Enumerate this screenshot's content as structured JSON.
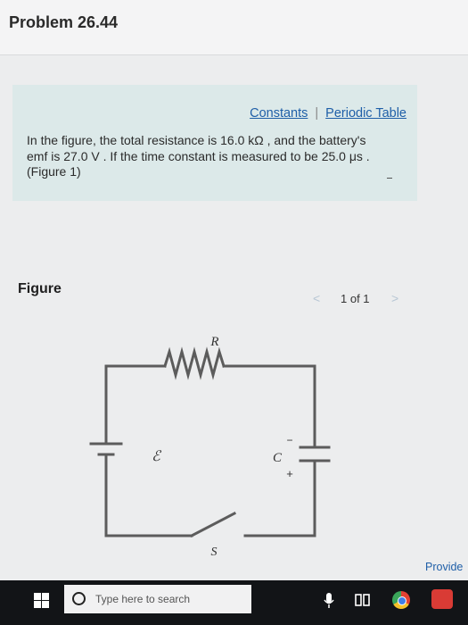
{
  "problem": {
    "title": "Problem 26.44"
  },
  "panel": {
    "constants_link": "Constants",
    "separator": "|",
    "periodic_link": "Periodic Table",
    "line1": "In the figure, the total resistance is 16.0 kΩ , and the battery's",
    "line2": "emf is 27.0 V . If the time constant is measured to be 25.0 μs .",
    "figure_ref": "(Figure 1)"
  },
  "figure": {
    "label": "Figure",
    "pager_text": "1 of 1",
    "prev_glyph": "<",
    "next_glyph": ">",
    "labels": {
      "resistor": "R",
      "battery": "ℰ",
      "capacitor": "C",
      "minus": "−",
      "plus": "+",
      "switch": "S"
    }
  },
  "provide_link": "Provide",
  "taskbar": {
    "search_placeholder": "Type here to search"
  },
  "colors": {
    "panel_bg": "#dce9e9",
    "link": "#1f5fa8",
    "taskbar": "#121417"
  }
}
